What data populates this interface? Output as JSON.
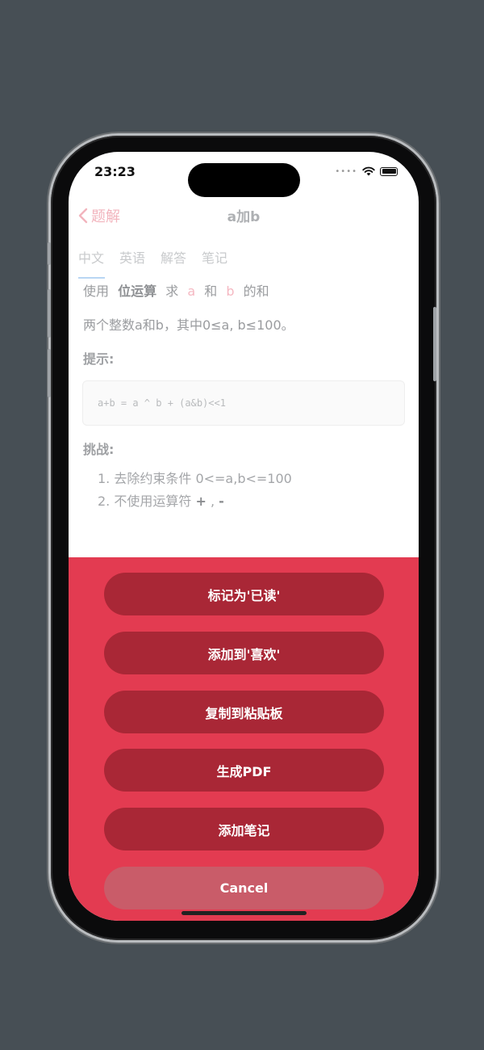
{
  "status": {
    "time": "23:23",
    "cell": "••••"
  },
  "nav": {
    "back_label": "题解",
    "title": "a加b"
  },
  "tabs": [
    "中文",
    "英语",
    "解答",
    "笔记"
  ],
  "problem": {
    "line1_pre": "使用",
    "line1_bold": "位运算",
    "line1_mid": "求",
    "var_a": "a",
    "line1_and": "和",
    "var_b": "b",
    "line1_post": "的和",
    "line2": "两个整数a和b，其中0≤a, b≤100。",
    "hint_heading": "提示:",
    "code": "a+b = a ^ b + (a&b)<<1",
    "challenge_heading": "挑战:",
    "challenge1": "1.  去除约束条件 0<=a,b<=100",
    "challenge2_pre": "2.  不使用运算符 ",
    "challenge2_bold1": "+",
    "challenge2_sep": " , ",
    "challenge2_bold2": "-"
  },
  "actions": {
    "mark_read": "标记为'已读'",
    "add_favorite": "添加到'喜欢'",
    "copy_clipboard": "复制到粘贴板",
    "generate_pdf": "生成PDF",
    "add_note": "添加笔记",
    "cancel": "Cancel"
  },
  "colors": {
    "sheet": "#e33b51",
    "button": "#a92736",
    "cancel_button": "#c95c69",
    "accent_pink": "#f2b4bd",
    "background": "#474f55"
  },
  "icons": {
    "back": "chevron-left-icon",
    "wifi": "wifi-icon",
    "battery": "battery-icon"
  }
}
